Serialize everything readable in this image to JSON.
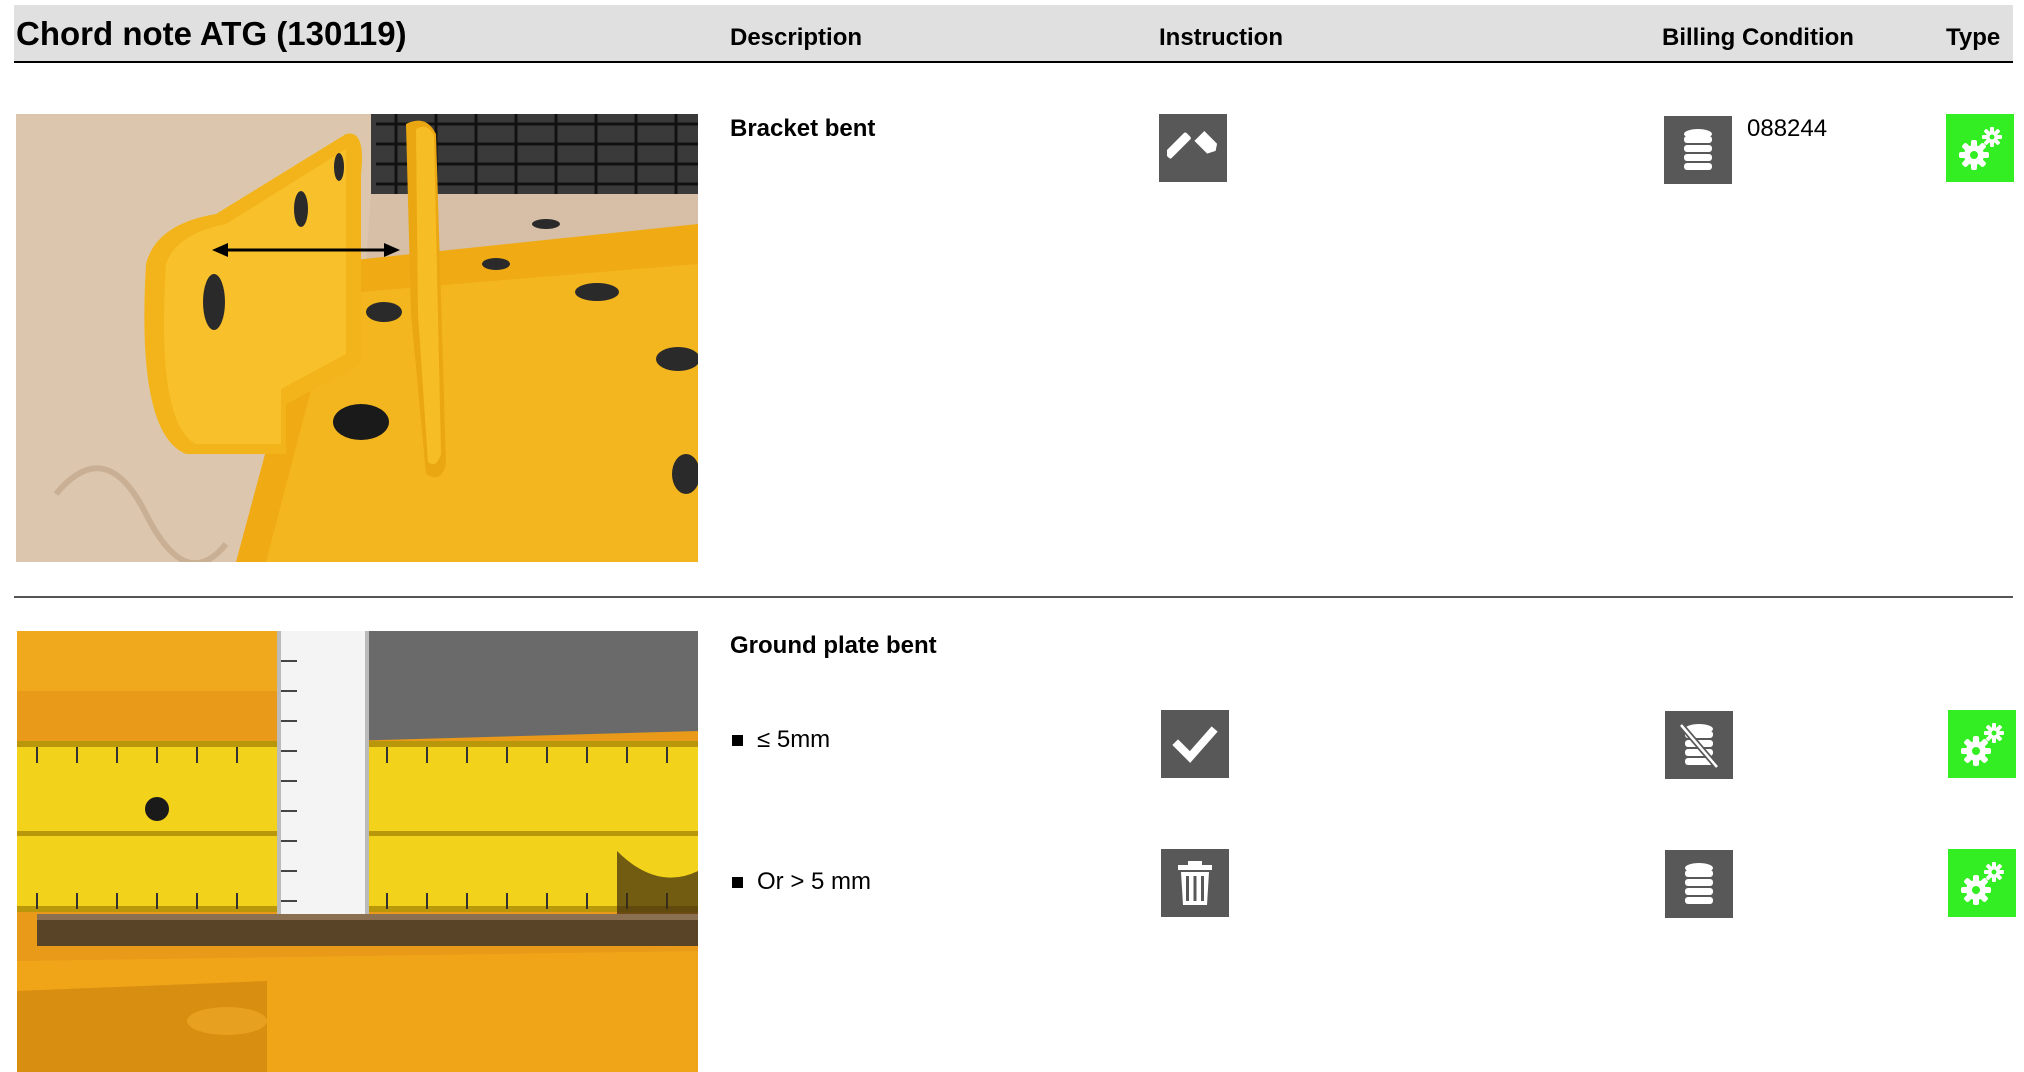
{
  "header": {
    "title": "Chord note ATG (130119)",
    "col_description": "Description",
    "col_instruction": "Instruction",
    "col_billing": "Billing Condition",
    "col_type": "Type"
  },
  "rows": [
    {
      "description": "Bracket bent",
      "instruction_icon": "hammer-icon",
      "billing_icon": "coin-stack-icon",
      "billing_code": "088244",
      "type_icon": "gears-icon"
    },
    {
      "description": "Ground plate bent",
      "options": [
        {
          "label": "≤ 5mm",
          "instruction_icon": "checkmark-icon",
          "billing_icon": "coin-stack-crossed-icon",
          "type_icon": "gears-icon"
        },
        {
          "label": "Or > 5 mm",
          "instruction_icon": "trash-icon",
          "billing_icon": "coin-stack-icon",
          "type_icon": "gears-icon"
        }
      ]
    }
  ],
  "colors": {
    "header_bg": "#e0e0e0",
    "icon_gray": "#585858",
    "icon_green": "#33ee22",
    "part_yellow": "#f2b81c"
  }
}
